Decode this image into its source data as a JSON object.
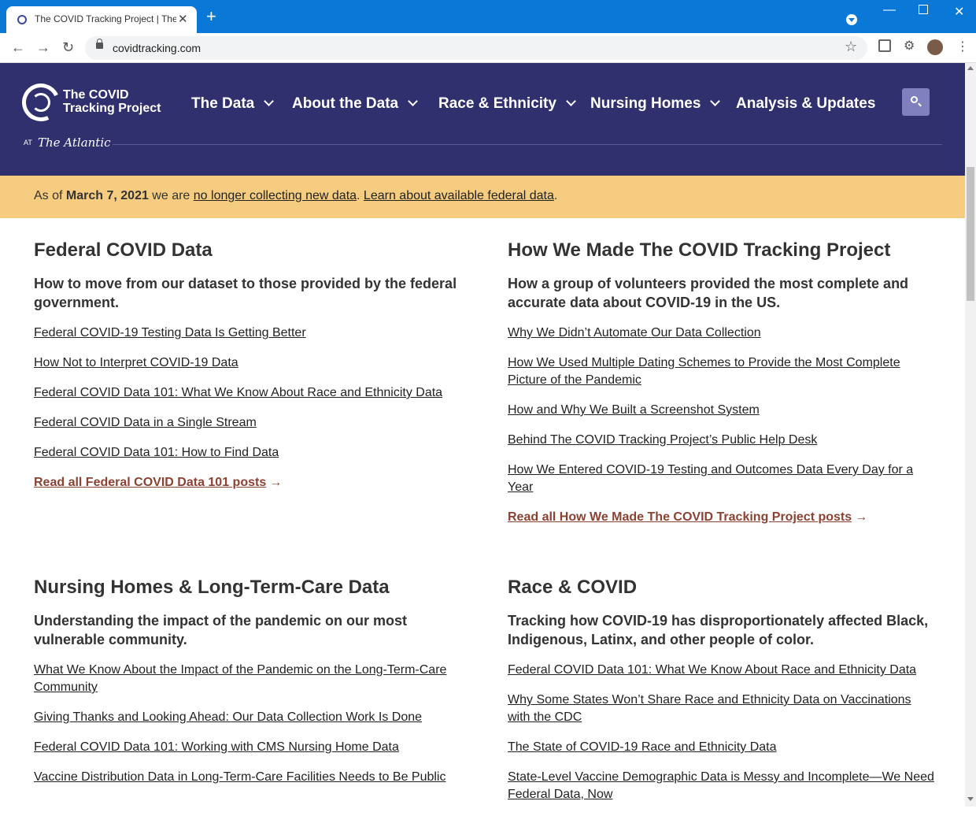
{
  "browser": {
    "tab_title": "The COVID Tracking Project | The Atlantic",
    "url": "covidtracking.com",
    "new_tab": "+",
    "close": "✕"
  },
  "header": {
    "logo_line1": "The COVID",
    "logo_line2": "Tracking Project",
    "at": "AT",
    "atlantic": "The Atlantic",
    "nav": [
      "The Data",
      "About the Data",
      "Race & Ethnicity",
      "Nursing Homes",
      "Analysis & Updates"
    ]
  },
  "banner": {
    "prefix": "As of ",
    "date": "March 7, 2021",
    "middle": " we are ",
    "link1": "no longer collecting new data",
    "sep": ". ",
    "link2": "Learn about available federal data",
    "suffix": "."
  },
  "sections": [
    {
      "title": "Federal COVID Data",
      "subtitle": "How to move from our dataset to those provided by the federal government.",
      "links": [
        "Federal COVID-19 Testing Data Is Getting Better",
        "How Not to Interpret COVID-19 Data",
        "Federal COVID Data 101: What We Know About Race and Ethnicity Data",
        "Federal COVID Data in a Single Stream",
        "Federal COVID Data 101: How to Find Data"
      ],
      "more": "Read all Federal COVID Data 101 posts"
    },
    {
      "title": "How We Made The COVID Tracking Project",
      "subtitle": "How a group of volunteers provided the most complete and accurate data about COVID-19 in the US.",
      "links": [
        "Why We Didn’t Automate Our Data Collection",
        "How We Used Multiple Dating Schemes to Provide the Most Complete Picture of the Pandemic",
        "How and Why We Built a Screenshot System",
        "Behind The COVID Tracking Project’s Public Help Desk",
        "How We Entered COVID-19 Testing and Outcomes Data Every Day for a Year"
      ],
      "more": "Read all How We Made The COVID Tracking Project posts"
    },
    {
      "title": "Nursing Homes & Long-Term-Care Data",
      "subtitle": "Understanding the impact of the pandemic on our most vulnerable community.",
      "links": [
        "What We Know About the Impact of the Pandemic on the Long-Term-Care Community",
        "Giving Thanks and Looking Ahead: Our Data Collection Work Is Done",
        "Federal COVID Data 101: Working with CMS Nursing Home Data",
        "Vaccine Distribution Data in Long-Term-Care Facilities Needs to Be Public"
      ]
    },
    {
      "title": "Race & COVID",
      "subtitle": "Tracking how COVID-19 has disproportionately affected Black, Indigenous, Latinx, and other people of color.",
      "links": [
        "Federal COVID Data 101: What We Know About Race and Ethnicity Data",
        "Why Some States Won’t Share Race and Ethnicity Data on Vaccinations with the CDC",
        "The State of COVID-19 Race and Ethnicity Data",
        "State-Level Vaccine Demographic Data is Messy and Incomplete—We Need Federal Data, Now"
      ]
    }
  ],
  "arrow": "→"
}
